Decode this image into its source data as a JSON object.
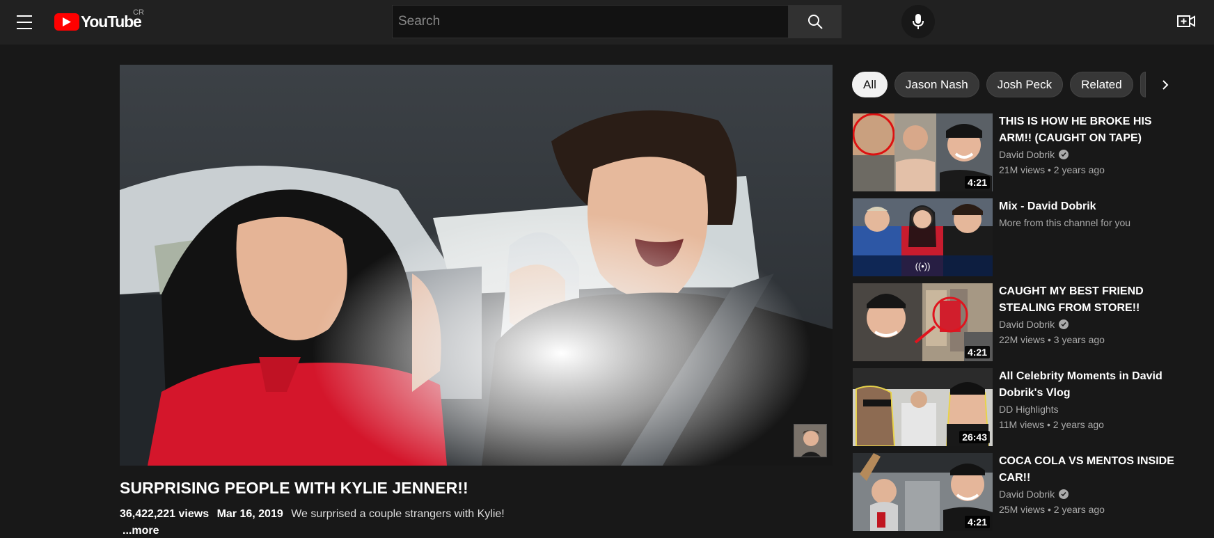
{
  "header": {
    "logo_text": "YouTube",
    "country_code": "CR",
    "search_placeholder": "Search"
  },
  "player": {
    "title": "SURPRISING PEOPLE WITH KYLIE JENNER!!",
    "views": "36,422,221 views",
    "date": "Mar 16, 2019",
    "description": "We surprised a couple strangers with Kylie!",
    "more_label": "...more"
  },
  "chips": [
    {
      "label": "All",
      "active": true
    },
    {
      "label": "Jason Nash",
      "active": false
    },
    {
      "label": "Josh Peck",
      "active": false
    },
    {
      "label": "Related",
      "active": false
    }
  ],
  "recommendations": [
    {
      "title": "THIS IS HOW HE BROKE HIS ARM!! (CAUGHT ON TAPE)",
      "channel": "David Dobrik",
      "verified": true,
      "stats": "21M views • 2 years ago",
      "duration": "4:21"
    },
    {
      "title": "Mix - David Dobrik",
      "channel": "More from this channel for you",
      "verified": false,
      "stats": "",
      "duration": "",
      "mix_icon": "((•))"
    },
    {
      "title": "CAUGHT MY BEST FRIEND STEALING FROM STORE!!",
      "channel": "David Dobrik",
      "verified": true,
      "stats": "22M views • 3 years ago",
      "duration": "4:21"
    },
    {
      "title": "All Celebrity Moments in David Dobrik's Vlog",
      "channel": "DD Highlights",
      "verified": false,
      "stats": "11M views • 2 years ago",
      "duration": "26:43"
    },
    {
      "title": "COCA COLA VS MENTOS INSIDE CAR!!",
      "channel": "David Dobrik",
      "verified": true,
      "stats": "25M views • 2 years ago",
      "duration": "4:21"
    }
  ],
  "colors": {
    "background": "#181818",
    "topbar": "#212121",
    "brand_red": "#ff0000",
    "chip_bg": "#373737",
    "secondary_text": "#aaaaaa"
  }
}
